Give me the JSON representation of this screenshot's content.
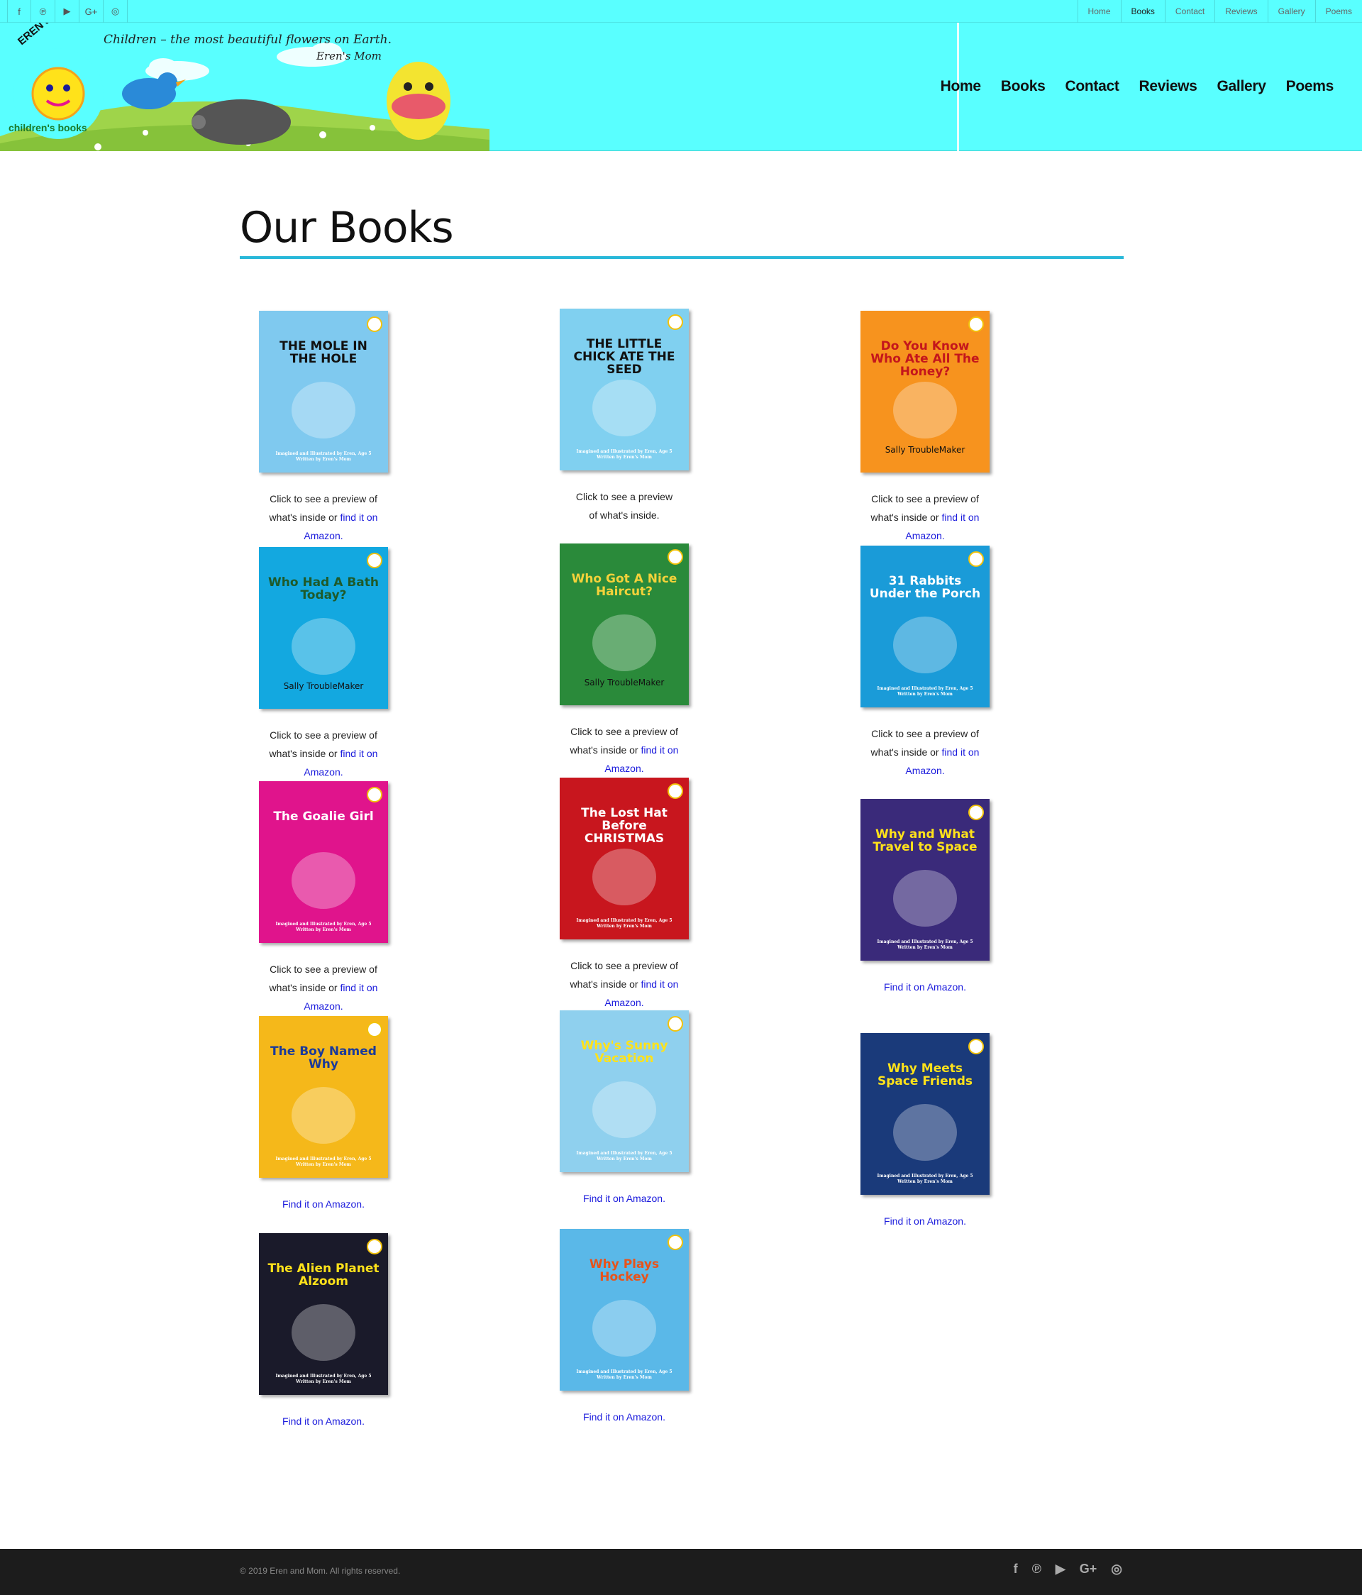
{
  "topbar": {
    "social": [
      {
        "icon": "facebook-icon",
        "glyph": "f"
      },
      {
        "icon": "pinterest-icon",
        "glyph": "℗"
      },
      {
        "icon": "youtube-icon",
        "glyph": "▶"
      },
      {
        "icon": "google-plus-icon",
        "glyph": "G+"
      },
      {
        "icon": "instagram-icon",
        "glyph": "◎"
      }
    ],
    "links": [
      "Home",
      "Books",
      "Contact",
      "Reviews",
      "Gallery",
      "Poems"
    ],
    "active": "Books"
  },
  "header": {
    "logo_top": "EREN and MOM",
    "logo_bottom": "children's books",
    "tagline": "Children – the most beautiful flowers on Earth.",
    "signature": "Eren's Mom",
    "nav": [
      "Home",
      "Books",
      "Contact",
      "Reviews",
      "Gallery",
      "Poems"
    ]
  },
  "page": {
    "title": "Our Books"
  },
  "captions": {
    "preview_prefix": "Click to see a preview of what's inside or ",
    "amazon_link": "find it on Amazon.",
    "preview_only": "Click to see a preview of what's inside.",
    "amazon_only": "Find it on Amazon."
  },
  "books": [
    {
      "title": "THE MOLE IN THE HOLE",
      "caption": "preview_amazon",
      "bg": "#7fc9ef",
      "accent": "#3c8a2a"
    },
    {
      "title": "THE LITTLE CHICK ATE THE SEED",
      "caption": "preview",
      "bg": "#80d0f0",
      "accent": "#4aa02c"
    },
    {
      "title": "Do You Know Who Ate All The Honey?",
      "author": "Sally TroubleMaker",
      "caption": "preview_amazon",
      "bg": "#f7931e",
      "accent": "#c4161c"
    },
    {
      "title": "Who Had A Bath Today?",
      "author": "Sally TroubleMaker",
      "caption": "preview_amazon",
      "bg": "#13a8e0",
      "accent": "#1e5a2a"
    },
    {
      "title": "Who Got A Nice Haircut?",
      "author": "Sally TroubleMaker",
      "caption": "preview_amazon",
      "bg": "#2a8a3a",
      "accent": "#f4d23a"
    },
    {
      "title": "31 Rabbits Under the Porch",
      "caption": "preview_amazon",
      "bg": "#1a9bd8",
      "accent": "#ffffff"
    },
    {
      "title": "The Goalie Girl",
      "caption": "preview_amazon",
      "bg": "#e0148c",
      "accent": "#ffffff"
    },
    {
      "title": "The Lost Hat Before CHRISTMAS",
      "caption": "preview_amazon",
      "bg": "#c8161e",
      "accent": "#ffffff"
    },
    {
      "title": "Why and What Travel to Space",
      "caption": "amazon",
      "bg": "#3a2a7a",
      "accent": "#ffe21a"
    },
    {
      "title": "The Boy Named Why",
      "caption": "amazon",
      "bg": "#f5b81a",
      "accent": "#1a3a9a"
    },
    {
      "title": "Why's Sunny Vacation",
      "caption": "amazon",
      "bg": "#8fd0ee",
      "accent": "#ffe21a"
    },
    {
      "title": "Why Meets Space Friends",
      "caption": "amazon",
      "bg": "#1a3a7a",
      "accent": "#ffe21a"
    },
    {
      "title": "The Alien Planet Alzoom",
      "caption": "amazon",
      "bg": "#1a1a2a",
      "accent": "#ffe21a"
    },
    {
      "title": "Why Plays Hockey",
      "caption": "amazon",
      "bg": "#5ab8e8",
      "accent": "#e8531a"
    }
  ],
  "cover_credits": [
    "Imagined and Illustrated by Eren, Age 5",
    "Written by Eren's Mom"
  ],
  "footer": {
    "copyright": "© 2019 Eren and Mom. All rights reserved.",
    "social": [
      {
        "icon": "facebook-icon",
        "glyph": "f"
      },
      {
        "icon": "pinterest-icon",
        "glyph": "℗"
      },
      {
        "icon": "youtube-icon",
        "glyph": "▶"
      },
      {
        "icon": "google-plus-icon",
        "glyph": "G+"
      },
      {
        "icon": "instagram-icon",
        "glyph": "◎"
      }
    ]
  }
}
